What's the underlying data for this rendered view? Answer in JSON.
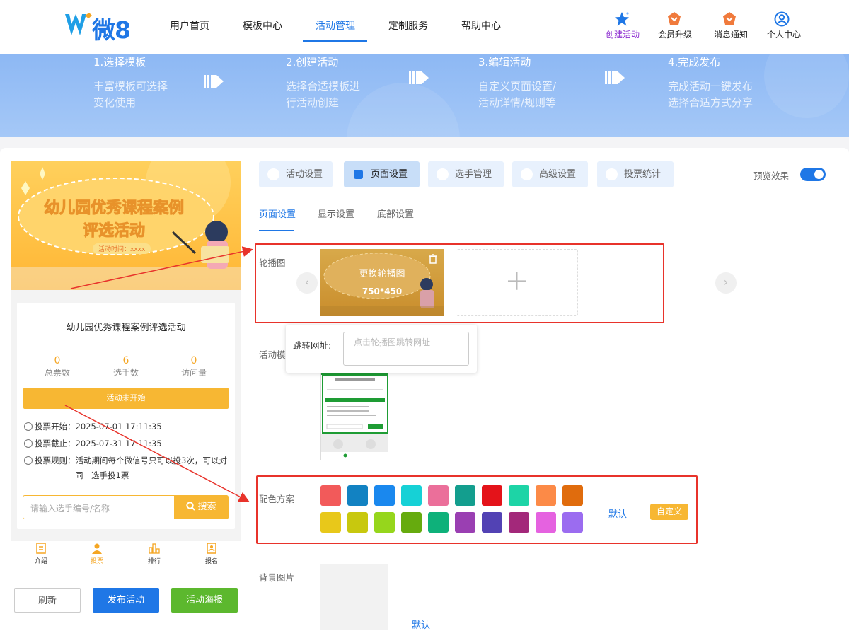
{
  "header": {
    "logo_text": "微8",
    "nav": [
      {
        "label": "用户首页",
        "active": false
      },
      {
        "label": "模板中心",
        "active": false
      },
      {
        "label": "活动管理",
        "active": true
      },
      {
        "label": "定制服务",
        "active": false
      },
      {
        "label": "帮助中心",
        "active": false
      }
    ],
    "tools": [
      {
        "label": "创建活动",
        "icon": "star-icon",
        "color": "#1f77e6"
      },
      {
        "label": "会员升级",
        "icon": "crown-icon",
        "color": "#f07a3c"
      },
      {
        "label": "消息通知",
        "icon": "bell-icon",
        "color": "#f07a3c"
      },
      {
        "label": "个人中心",
        "icon": "user-circle-icon",
        "color": "#1f77e6"
      }
    ]
  },
  "steps": [
    {
      "title": "1.选择模板",
      "desc1": "丰富模板可选择",
      "desc2": "变化使用"
    },
    {
      "title": "2.创建活动",
      "desc1": "选择合适模板进",
      "desc2": "行活动创建"
    },
    {
      "title": "3.编辑活动",
      "desc1": "自定义页面设置/",
      "desc2": "活动详情/规则等"
    },
    {
      "title": "4.完成发布",
      "desc1": "完成活动一键发布",
      "desc2": "选择合适方式分享"
    }
  ],
  "preview": {
    "poster_title1": "幼儿园优秀课程案例",
    "poster_title2": "评选活动",
    "poster_time": "活动时间：xxxx",
    "title": "幼儿园优秀课程案例评选活动",
    "stats": [
      {
        "value": "0",
        "label": "总票数"
      },
      {
        "value": "6",
        "label": "选手数"
      },
      {
        "value": "0",
        "label": "访问量"
      }
    ],
    "status": "活动未开始",
    "vote_start_label": "投票开始：",
    "vote_start": "2025-07-01 17:11:35",
    "vote_end_label": "投票截止：",
    "vote_end": "2025-07-31 17:11:35",
    "rule_label": "投票规则：",
    "rule_text1": "活动期间每个微信号只可以投3次，可以对",
    "rule_text2": "同一选手投1票",
    "search_placeholder": "请输入选手编号/名称",
    "search_button": "搜索",
    "tabs": [
      {
        "label": "介绍",
        "icon": "doc-icon",
        "active": false
      },
      {
        "label": "投票",
        "icon": "person-icon",
        "active": true
      },
      {
        "label": "排行",
        "icon": "rank-icon",
        "active": false
      },
      {
        "label": "报名",
        "icon": "signup-icon",
        "active": false
      }
    ]
  },
  "actions": {
    "refresh": "刷新",
    "publish": "发布活动",
    "poster": "活动海报"
  },
  "settings": {
    "top_tabs": [
      {
        "label": "活动设置",
        "active": false
      },
      {
        "label": "页面设置",
        "active": true
      },
      {
        "label": "选手管理",
        "active": false
      },
      {
        "label": "高级设置",
        "active": false
      },
      {
        "label": "投票统计",
        "active": false
      }
    ],
    "preview_label": "预览效果",
    "preview_on": true,
    "sub_tabs": [
      {
        "label": "页面设置",
        "active": true
      },
      {
        "label": "显示设置",
        "active": false
      },
      {
        "label": "底部设置",
        "active": false
      }
    ],
    "carousel_label": "轮播图",
    "carousel_replace": "更换轮播图",
    "carousel_size": "750*450",
    "jump_label": "跳转网址:",
    "jump_placeholder": "点击轮播图跳转网址",
    "template_label": "活动模",
    "color_label": "配色方案",
    "colors_row1": [
      "#f25a5a",
      "#1282c2",
      "#1a88ee",
      "#16d1d6",
      "#eb6f9a",
      "#139e8e",
      "#e4131a",
      "#1dd4a6",
      "#fc8a47",
      "#e06c0d"
    ],
    "colors_row2": [
      "#e8c81a",
      "#c8c80e",
      "#96d61c",
      "#66ab0e",
      "#0eb17a",
      "#9a3fb2",
      "#5242b4",
      "#a3287a",
      "#e562e0",
      "#9b6cf0"
    ],
    "color_default": "默认",
    "color_custom": "自定义",
    "bg_label": "背景图片",
    "bg_default": "默认"
  }
}
